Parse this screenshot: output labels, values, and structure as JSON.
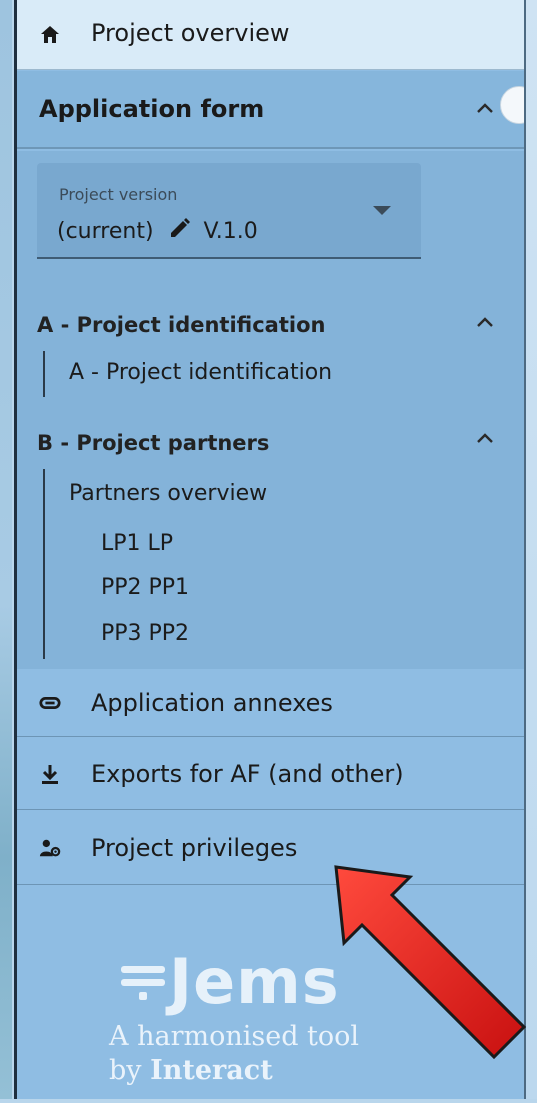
{
  "nav": {
    "overview_label": "Project overview",
    "application_form_label": "Application form",
    "annexes_label": "Application annexes",
    "exports_label": "Exports for AF (and other)",
    "privileges_label": "Project privileges"
  },
  "version": {
    "field_label": "Project version",
    "current_prefix": "(current)",
    "value": "V.1.0"
  },
  "sections": {
    "a_title": "A - Project identification",
    "a_items": [
      "A - Project identification"
    ],
    "b_title": "B - Project partners",
    "b_overview": "Partners overview",
    "b_partners": [
      "LP1 LP",
      "PP2 PP1",
      "PP3 PP2"
    ]
  },
  "branding": {
    "logo_text": "Jems",
    "tagline_line1": "A harmonised tool",
    "tagline_by": "by",
    "tagline_brand": "Interact"
  },
  "colors": {
    "sidebar_bg": "#8fbde3",
    "active_row_bg": "#d9ebf8",
    "arrow_red": "#e41b17"
  },
  "icons": {
    "overview": "home-icon",
    "annexes": "paperclip-icon",
    "exports": "download-icon",
    "privileges": "user-settings-icon"
  }
}
